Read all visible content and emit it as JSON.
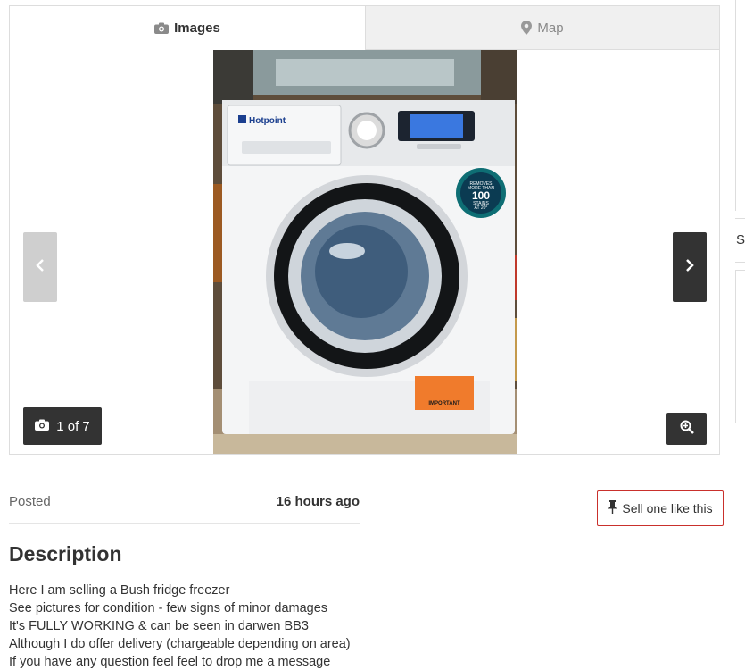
{
  "gallery": {
    "tabs": [
      {
        "label": "Images",
        "icon": "camera-icon",
        "active": true
      },
      {
        "label": "Map",
        "icon": "map-pin-icon",
        "active": false
      }
    ],
    "counter": "1 of 7",
    "photo": {
      "brand": "Hotpoint",
      "badge": [
        "REMOVES",
        "MORE THAN",
        "100",
        "STAINS",
        "AT 20°"
      ],
      "sticker": "IMPORTANT"
    },
    "icons": {
      "prev": "chevron-left-icon",
      "next": "chevron-right-icon",
      "zoom": "zoom-in-icon",
      "counter": "camera-icon"
    }
  },
  "right_fragment": {
    "letter": "S"
  },
  "posted": {
    "label": "Posted",
    "value": "16 hours ago"
  },
  "sell_button": {
    "label": "Sell one like this",
    "icon": "pin-icon"
  },
  "description": {
    "title": "Description",
    "lines": [
      "Here I am selling a Bush fridge freezer",
      "See pictures for condition - few signs of minor damages",
      "It's FULLY WORKING & can be seen in darwen BB3",
      "Although I do offer delivery (chargeable depending on area)",
      "If you have any question feel feel to drop me a message"
    ]
  },
  "colors": {
    "dark_button": "#333333",
    "accent_border": "#c9302c",
    "inactive_tab": "#f0f0f0"
  }
}
